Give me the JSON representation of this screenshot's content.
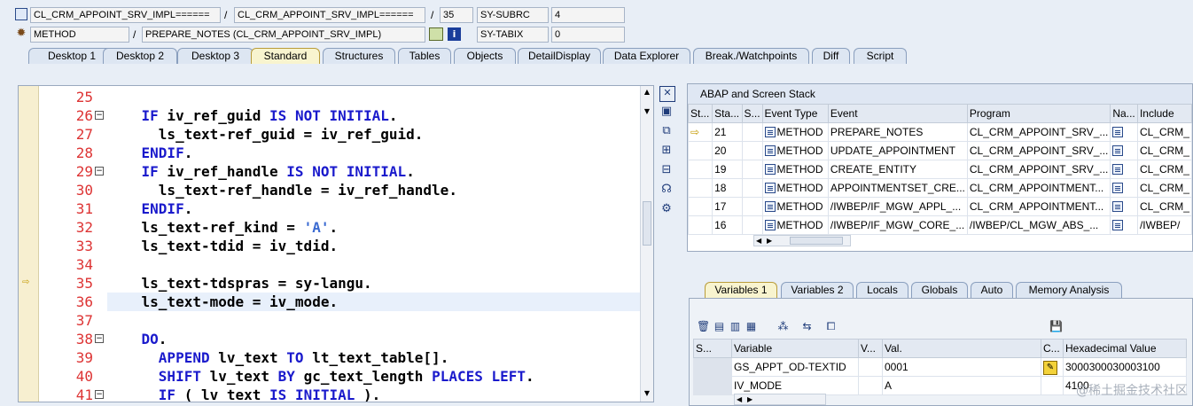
{
  "header": {
    "row1": {
      "field1": "CL_CRM_APPOINT_SRV_IMPL======",
      "field2": "CL_CRM_APPOINT_SRV_IMPL======",
      "line": "35",
      "sysvar": "SY-SUBRC",
      "sysval": "4"
    },
    "row2": {
      "type": "METHOD",
      "name": "PREPARE_NOTES (CL_CRM_APPOINT_SRV_IMPL)",
      "sysvar": "SY-TABIX",
      "sysval": "0"
    },
    "separator": "/"
  },
  "tabs": [
    "Desktop 1",
    "Desktop 2",
    "Desktop 3",
    "Standard",
    "Structures",
    "Tables",
    "Objects",
    "DetailDisplay",
    "Data Explorer",
    "Break./Watchpoints",
    "Diff",
    "Script"
  ],
  "active_tab": "Standard",
  "editor": {
    "lines": [
      {
        "num": "25",
        "code": ""
      },
      {
        "num": "26",
        "code": "    IF iv_ref_guid IS NOT INITIAL."
      },
      {
        "num": "27",
        "code": "      ls_text-ref_guid = iv_ref_guid."
      },
      {
        "num": "28",
        "code": "    ENDIF."
      },
      {
        "num": "29",
        "code": "    IF iv_ref_handle IS NOT INITIAL."
      },
      {
        "num": "30",
        "code": "      ls_text-ref_handle = iv_ref_handle."
      },
      {
        "num": "31",
        "code": "    ENDIF."
      },
      {
        "num": "32",
        "code": "    ls_text-ref_kind = 'A'."
      },
      {
        "num": "33",
        "code": "    ls_text-tdid = iv_tdid."
      },
      {
        "num": "34",
        "code": ""
      },
      {
        "num": "35",
        "code": "    ls_text-tdspras = sy-langu."
      },
      {
        "num": "36",
        "code": "    ls_text-mode = iv_mode."
      },
      {
        "num": "37",
        "code": ""
      },
      {
        "num": "38",
        "code": "    DO."
      },
      {
        "num": "39",
        "code": "      APPEND lv_text TO lt_text_table[]."
      },
      {
        "num": "40",
        "code": "      SHIFT lv_text BY gc_text_length PLACES LEFT."
      },
      {
        "num": "41",
        "code": "      IF ( lv_text IS INITIAL )."
      }
    ],
    "current_line": "35",
    "cursor_line": "36"
  },
  "stack": {
    "title": "ABAP and Screen Stack",
    "columns": [
      "St...",
      "Sta...",
      "S...",
      "Event Type",
      "Event",
      "Program",
      "Na...",
      "Include"
    ],
    "rows": [
      {
        "step": "21",
        "type": "METHOD",
        "event": "PREPARE_NOTES",
        "program": "CL_CRM_APPOINT_SRV_...",
        "include": "CL_CRM_",
        "current": true
      },
      {
        "step": "20",
        "type": "METHOD",
        "event": "UPDATE_APPOINTMENT",
        "program": "CL_CRM_APPOINT_SRV_...",
        "include": "CL_CRM_",
        "current": false
      },
      {
        "step": "19",
        "type": "METHOD",
        "event": "CREATE_ENTITY",
        "program": "CL_CRM_APPOINT_SRV_...",
        "include": "CL_CRM_",
        "current": false
      },
      {
        "step": "18",
        "type": "METHOD",
        "event": "APPOINTMENTSET_CRE...",
        "program": "CL_CRM_APPOINTMENT...",
        "include": "CL_CRM_",
        "current": false
      },
      {
        "step": "17",
        "type": "METHOD",
        "event": "/IWBEP/IF_MGW_APPL_...",
        "program": "CL_CRM_APPOINTMENT...",
        "include": "CL_CRM_",
        "current": false
      },
      {
        "step": "16",
        "type": "METHOD",
        "event": "/IWBEP/IF_MGW_CORE_...",
        "program": "/IWBEP/CL_MGW_ABS_...",
        "include": "/IWBEP/",
        "current": false
      }
    ]
  },
  "var_tabs": [
    "Variables 1",
    "Variables 2",
    "Locals",
    "Globals",
    "Auto",
    "Memory Analysis"
  ],
  "active_var_tab": "Variables 1",
  "variables": {
    "columns": [
      "S...",
      "Variable",
      "V...",
      "Val.",
      "C...",
      "Hexadecimal Value"
    ],
    "rows": [
      {
        "name": "GS_APPT_OD-TEXTID",
        "value": "0001",
        "hex": "3000300030003100"
      },
      {
        "name": "IV_MODE",
        "value": "A",
        "hex": "4100"
      }
    ]
  },
  "watermark": "@稀土掘金技术社区"
}
